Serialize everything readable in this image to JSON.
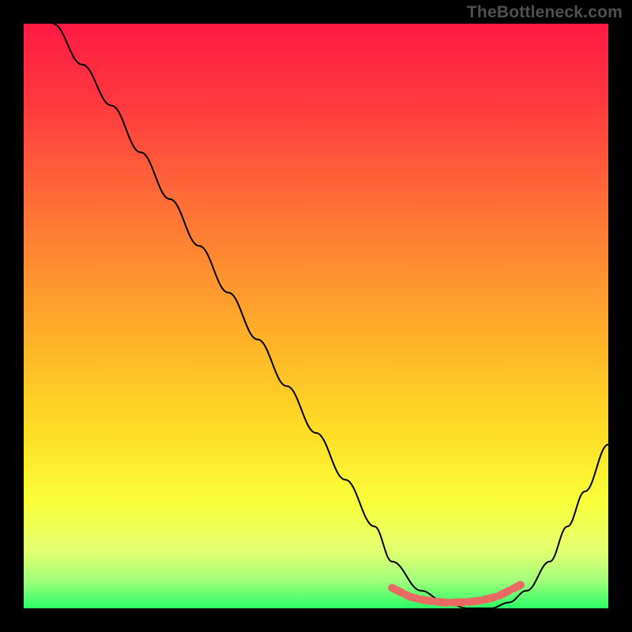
{
  "watermark": "TheBottleneck.com",
  "chart_data": {
    "type": "line",
    "title": "",
    "xlabel": "",
    "ylabel": "",
    "xlim": [
      0,
      100
    ],
    "ylim": [
      0,
      100
    ],
    "grid": false,
    "series": [
      {
        "name": "curve",
        "x": [
          5,
          10,
          15,
          20,
          25,
          30,
          35,
          40,
          45,
          50,
          55,
          60,
          63,
          68,
          72,
          76,
          80,
          83,
          86,
          90,
          93,
          96,
          100
        ],
        "y": [
          100,
          93,
          86,
          78,
          70,
          62,
          54,
          46,
          38,
          30,
          22,
          14,
          8,
          3,
          1,
          0,
          0,
          1,
          3,
          8,
          14,
          20,
          28
        ],
        "marker": "none",
        "stroke": "#000000",
        "width": 2
      },
      {
        "name": "beads",
        "x": [
          63,
          66,
          68,
          70,
          72,
          74,
          76,
          78,
          81,
          83,
          85
        ],
        "y": [
          3.5,
          2.0,
          1.5,
          1.2,
          1.0,
          1.0,
          1.1,
          1.3,
          2.0,
          3.0,
          4.0
        ],
        "marker": "round",
        "fill": "#e86a62",
        "width": 10
      }
    ],
    "gradient_stops": [
      {
        "offset": "0%",
        "color": "#ff1a42"
      },
      {
        "offset": "14%",
        "color": "#ff3a3f"
      },
      {
        "offset": "28%",
        "color": "#ff6638"
      },
      {
        "offset": "42%",
        "color": "#ff8f30"
      },
      {
        "offset": "56%",
        "color": "#ffb728"
      },
      {
        "offset": "70%",
        "color": "#ffde25"
      },
      {
        "offset": "82%",
        "color": "#f9ff3a"
      },
      {
        "offset": "90%",
        "color": "#e4ff70"
      },
      {
        "offset": "95%",
        "color": "#a7ff7b"
      },
      {
        "offset": "100%",
        "color": "#2bff68"
      }
    ]
  }
}
